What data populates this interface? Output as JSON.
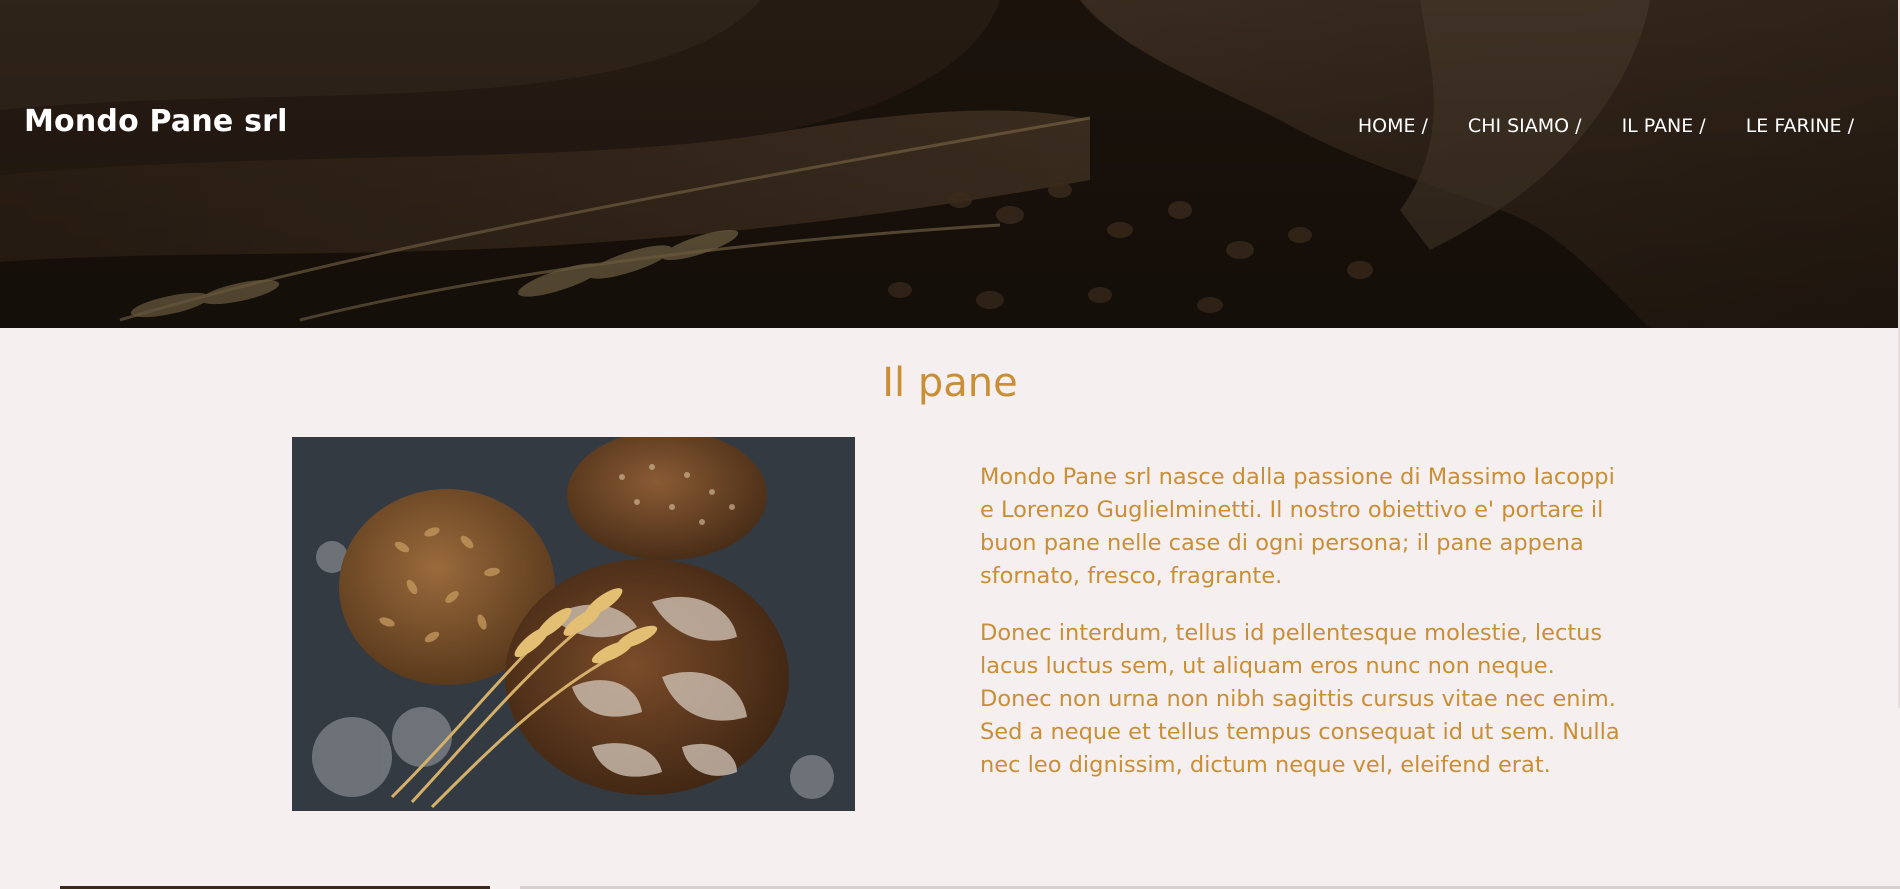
{
  "header": {
    "brand": "Mondo Pane srl",
    "nav": [
      {
        "label": "HOME /"
      },
      {
        "label": "CHI SIAMO /"
      },
      {
        "label": "IL PANE /"
      },
      {
        "label": "LE FARINE /"
      }
    ]
  },
  "main": {
    "title": "Il pane",
    "paragraphs": [
      "Mondo Pane srl nasce dalla passione di Massimo Iacoppi e Lorenzo Guglielminetti. Il nostro obiettivo e' portare il buon pane nelle case di ogni persona; il pane appena sfornato, fresco, fragrante.",
      "Donec interdum, tellus id pellentesque molestie, lectus lacus luctus sem, ut aliquam eros nunc non neque. Donec non urna non nibh sagittis cursus vitae nec enim. Sed a neque et tellus tempus consequat id ut sem. Nulla nec leo dignissim, dictum neque vel, eleifend erat."
    ]
  },
  "colors": {
    "accent": "#c98f36",
    "background": "#f6efef",
    "hero_overlay": "#2a1d12"
  }
}
